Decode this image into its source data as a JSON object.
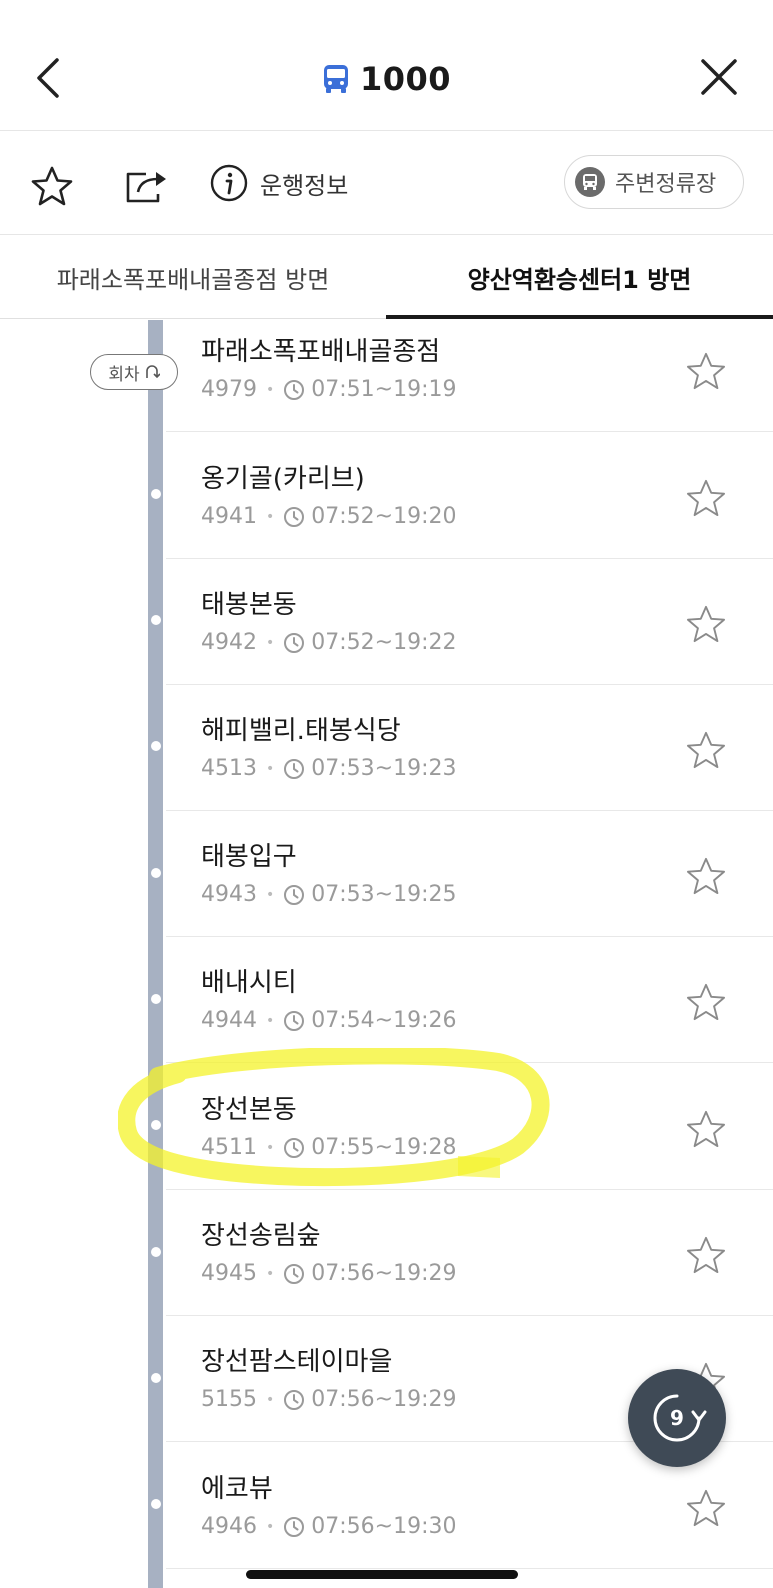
{
  "header": {
    "route_number": "1000",
    "bus_icon_color": "#3b6fd8"
  },
  "toolbar": {
    "info_label": "운행정보",
    "nearby_label": "주변정류장"
  },
  "tabs": [
    {
      "label": "파래소폭포배내골종점 방면",
      "selected": false
    },
    {
      "label": "양산역환승센터1 방면",
      "selected": true
    }
  ],
  "turn_badge": "회차",
  "stops": [
    {
      "name": "파래소폭포배내골종점",
      "id": "4979",
      "hours": "07:51~19:19"
    },
    {
      "name": "옹기골(카리브)",
      "id": "4941",
      "hours": "07:52~19:20"
    },
    {
      "name": "태봉본동",
      "id": "4942",
      "hours": "07:52~19:22"
    },
    {
      "name": "해피밸리.태봉식당",
      "id": "4513",
      "hours": "07:53~19:23"
    },
    {
      "name": "태봉입구",
      "id": "4943",
      "hours": "07:53~19:25"
    },
    {
      "name": "배내시티",
      "id": "4944",
      "hours": "07:54~19:26"
    },
    {
      "name": "장선본동",
      "id": "4511",
      "hours": "07:55~19:28"
    },
    {
      "name": "장선송림숲",
      "id": "4945",
      "hours": "07:56~19:29"
    },
    {
      "name": "장선팜스테이마을",
      "id": "5155",
      "hours": "07:56~19:29"
    },
    {
      "name": "에코뷰",
      "id": "4946",
      "hours": "07:56~19:30"
    }
  ],
  "refresh": {
    "count": "9"
  },
  "colors": {
    "route_line": "#a7b1c2",
    "highlight": "#f4f32a",
    "fab_bg": "#3f4a56"
  }
}
